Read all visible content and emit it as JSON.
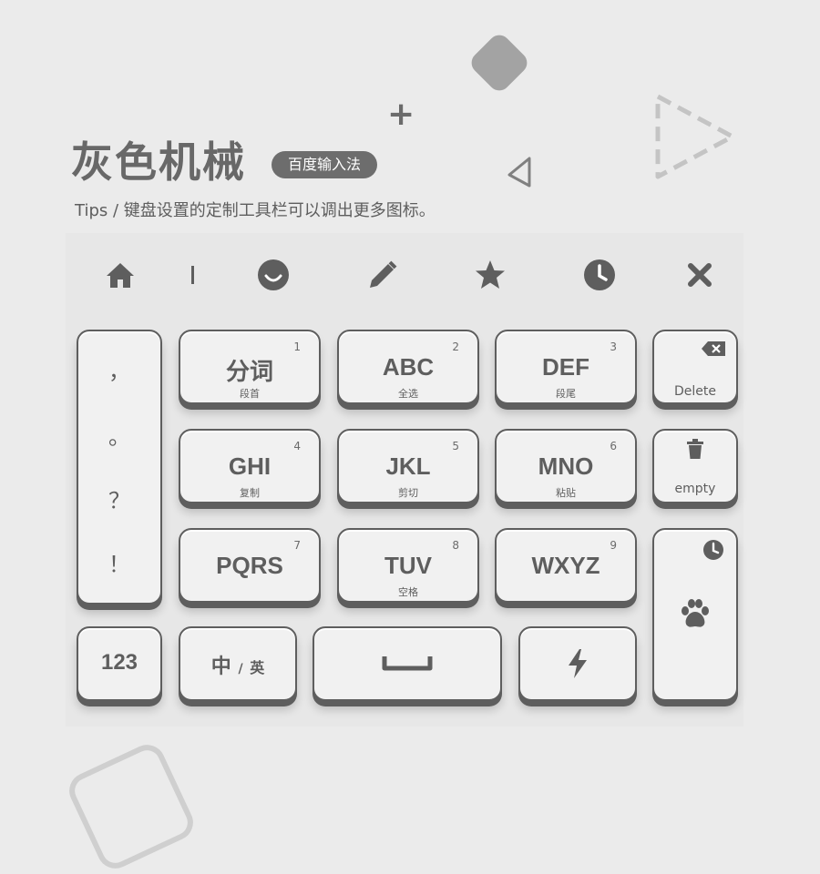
{
  "title": "灰色机械",
  "badge": "百度输入法",
  "tips": "Tips / 键盘设置的定制工具栏可以调出更多图标。",
  "toolbar": {
    "icons": [
      "home-icon",
      "cursor-icon",
      "emoji-icon",
      "pencil-icon",
      "star-icon",
      "clock-icon",
      "close-icon"
    ]
  },
  "left_column": {
    "punctuation": [
      "，",
      "。",
      "？",
      "！"
    ]
  },
  "keys": [
    {
      "main": "分词",
      "sub": "段首",
      "num": "1"
    },
    {
      "main": "ABC",
      "sub": "全选",
      "num": "2"
    },
    {
      "main": "DEF",
      "sub": "段尾",
      "num": "3"
    },
    {
      "main": "GHI",
      "sub": "复制",
      "num": "4"
    },
    {
      "main": "JKL",
      "sub": "剪切",
      "num": "5"
    },
    {
      "main": "MNO",
      "sub": "粘贴",
      "num": "6"
    },
    {
      "main": "PQRS",
      "sub": "",
      "num": "7"
    },
    {
      "main": "TUV",
      "sub": "空格",
      "num": "8"
    },
    {
      "main": "WXYZ",
      "sub": "",
      "num": "9"
    }
  ],
  "right_column": {
    "delete_label": "Delete",
    "empty_label": "empty"
  },
  "bottom_row": {
    "numbers_label": "123",
    "lang_cn": "中",
    "lang_sep": "/",
    "lang_en": "英"
  },
  "colors": {
    "key_face": "#f1f1f1",
    "key_edge": "#5e5e5e",
    "background": "#ebebeb",
    "badge": "#6d6d6d"
  }
}
